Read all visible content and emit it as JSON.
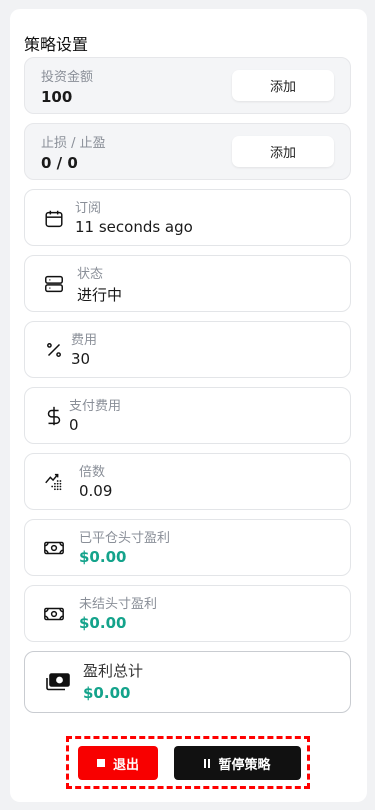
{
  "section_title": "策略设置",
  "investment": {
    "label": "投资金额",
    "value": "100",
    "add_label": "添加"
  },
  "stoploss": {
    "label": "止损 / 止盈",
    "value": "0 / 0",
    "add_label": "添加"
  },
  "info_rows": [
    {
      "icon": "calendar-icon",
      "label": "订阅",
      "value": "11 seconds ago"
    },
    {
      "icon": "server-icon",
      "label": "状态",
      "value": "进行中"
    },
    {
      "icon": "percent-icon",
      "label": "费用",
      "value": "30"
    },
    {
      "icon": "dollar-icon",
      "label": "支付费用",
      "value": "0"
    },
    {
      "icon": "trend-up-icon",
      "label": "倍数",
      "value": "0.09"
    },
    {
      "icon": "banknote-icon",
      "label": "已平仓头寸盈利",
      "value": "$0.00"
    },
    {
      "icon": "banknote-icon",
      "label": "未结头寸盈利",
      "value": "$0.00"
    },
    {
      "icon": "money-stack-icon",
      "label": "盈利总计",
      "value": "$0.00"
    }
  ],
  "actions": {
    "exit_label": "退出",
    "pause_label": "暂停策略"
  },
  "colors": {
    "green": "#14a38b",
    "red_button": "#f80000",
    "dark_button": "#111111"
  }
}
